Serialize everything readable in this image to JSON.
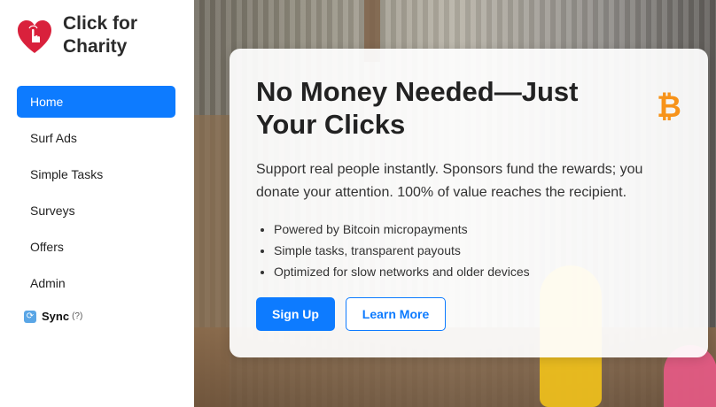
{
  "brand": {
    "title": "Click for Charity"
  },
  "nav": {
    "items": [
      {
        "label": "Home",
        "active": true
      },
      {
        "label": "Surf Ads"
      },
      {
        "label": "Simple Tasks"
      },
      {
        "label": "Surveys"
      },
      {
        "label": "Offers"
      },
      {
        "label": "Admin"
      }
    ],
    "sync": {
      "icon": "sync-icon",
      "label": "Sync",
      "help": "(?)"
    }
  },
  "hero": {
    "heading": "No Money Needed—Just Your Clicks",
    "icon": "bitcoin-icon",
    "description": "Support real people instantly. Sponsors fund the rewards; you donate your attention. 100% of value reaches the recipient.",
    "bullets": [
      "Powered by Bitcoin micropayments",
      "Simple tasks, transparent payouts",
      "Optimized for slow networks and older devices"
    ],
    "primary_button": "Sign Up",
    "secondary_button": "Learn More"
  },
  "colors": {
    "accent": "#0d7bff",
    "bitcoin": "#f7931a",
    "logo": "#d9213c"
  }
}
